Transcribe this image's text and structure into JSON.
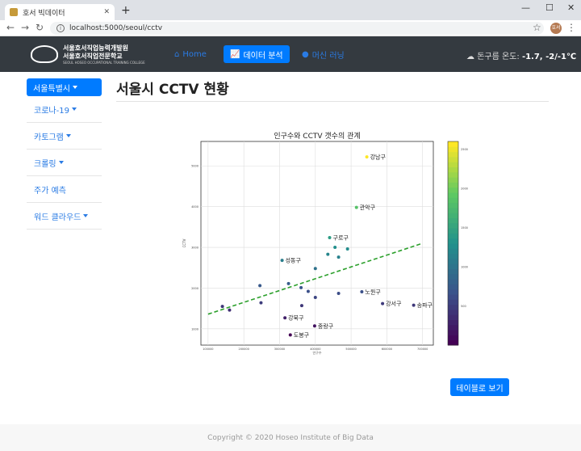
{
  "browser": {
    "tab_title": "호서 빅데이터",
    "url": "localhost:5000/seoul/cctv",
    "profile_label": "호서"
  },
  "nav": {
    "logo_line1": "서울호서직업능력개발원",
    "logo_line2": "서울호서직업전문학교",
    "logo_line3": "SEOUL HOSEO OCCUPATIONAL TRAINING COLLEGE",
    "home": "Home",
    "data_analysis": "데이터 분석",
    "machine_learning": "머신 러닝",
    "weather_label": "돈구름 온도:",
    "weather_value": "-1.7, -2/-1℃"
  },
  "sidebar": {
    "main": "서울특별시",
    "items": [
      "코로나-19",
      "카토그램",
      "크롤링",
      "주가 예측",
      "워드 클라우드"
    ]
  },
  "page": {
    "title": "서울시 CCTV 현황",
    "table_button": "테이블로 보기",
    "footer": "Copyright © 2020 Hoseo Institute of Big Data"
  },
  "colors": {
    "accent": "#007bff",
    "navbar": "#343a40",
    "trend": "#2ca02c"
  },
  "chart_data": {
    "type": "scatter",
    "title": "인구수와 CCTV 갯수의 관계",
    "xlabel": "인구수",
    "ylabel": "CCTV",
    "xlim": [
      80000,
      730000
    ],
    "ylim": [
      600,
      5600
    ],
    "xticks": [
      100000,
      200000,
      300000,
      400000,
      500000,
      600000,
      700000
    ],
    "yticks": [
      1000,
      2000,
      3000,
      4000,
      5000
    ],
    "colorbar_ticks": [
      500,
      1000,
      1500,
      2000,
      2500
    ],
    "colorbar_range": [
      0,
      2600
    ],
    "grid": true,
    "trend_line": {
      "x": [
        100000,
        700000
      ],
      "y": [
        1360,
        3100
      ]
    },
    "points": [
      {
        "x": 544000,
        "y": 5220,
        "label": "강남구"
      },
      {
        "x": 515000,
        "y": 3980,
        "label": "관악구"
      },
      {
        "x": 440000,
        "y": 3240,
        "label": "구로구"
      },
      {
        "x": 455000,
        "y": 3000,
        "label": ""
      },
      {
        "x": 435000,
        "y": 2830,
        "label": ""
      },
      {
        "x": 490000,
        "y": 2960,
        "label": ""
      },
      {
        "x": 465000,
        "y": 2760,
        "label": ""
      },
      {
        "x": 307000,
        "y": 2680,
        "label": "성동구"
      },
      {
        "x": 400000,
        "y": 2480,
        "label": ""
      },
      {
        "x": 245000,
        "y": 2060,
        "label": ""
      },
      {
        "x": 325000,
        "y": 2110,
        "label": ""
      },
      {
        "x": 360000,
        "y": 2010,
        "label": ""
      },
      {
        "x": 380000,
        "y": 1920,
        "label": ""
      },
      {
        "x": 400000,
        "y": 1770,
        "label": ""
      },
      {
        "x": 465000,
        "y": 1870,
        "label": ""
      },
      {
        "x": 530000,
        "y": 1910,
        "label": "노원구"
      },
      {
        "x": 248000,
        "y": 1640,
        "label": ""
      },
      {
        "x": 362000,
        "y": 1570,
        "label": ""
      },
      {
        "x": 140000,
        "y": 1550,
        "label": ""
      },
      {
        "x": 160000,
        "y": 1460,
        "label": ""
      },
      {
        "x": 588000,
        "y": 1620,
        "label": "강서구"
      },
      {
        "x": 675000,
        "y": 1580,
        "label": "송파구"
      },
      {
        "x": 315000,
        "y": 1270,
        "label": "강북구"
      },
      {
        "x": 398000,
        "y": 1070,
        "label": "중랑구"
      },
      {
        "x": 330000,
        "y": 850,
        "label": "도봉구"
      }
    ]
  }
}
